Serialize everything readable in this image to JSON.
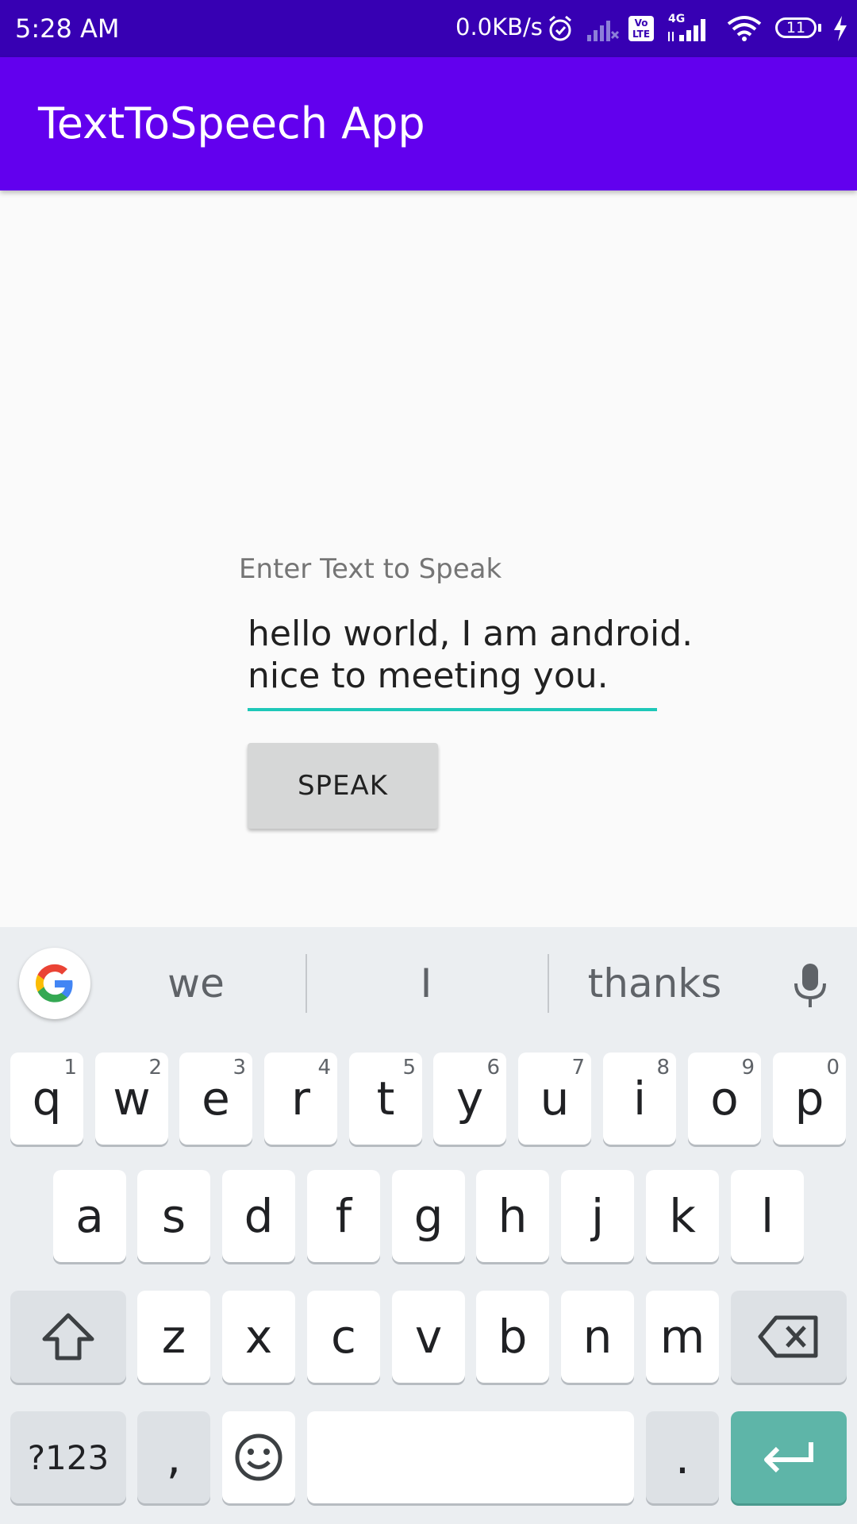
{
  "status_bar": {
    "time": "5:28 AM",
    "net_speed": "0.0KB/s",
    "volte": "Vo LTE",
    "network": "4G",
    "battery": "11"
  },
  "app_bar": {
    "title": "TextToSpeech App"
  },
  "form": {
    "label": "Enter Text to Speak",
    "input_lines": [
      "hello world, I am android.",
      "nice to meeting you."
    ],
    "speak_button": "SPEAK"
  },
  "keyboard": {
    "suggestions": [
      "we",
      "I",
      "thanks"
    ],
    "row1": [
      {
        "k": "q",
        "n": "1"
      },
      {
        "k": "w",
        "n": "2"
      },
      {
        "k": "e",
        "n": "3"
      },
      {
        "k": "r",
        "n": "4"
      },
      {
        "k": "t",
        "n": "5"
      },
      {
        "k": "y",
        "n": "6"
      },
      {
        "k": "u",
        "n": "7"
      },
      {
        "k": "i",
        "n": "8"
      },
      {
        "k": "o",
        "n": "9"
      },
      {
        "k": "p",
        "n": "0"
      }
    ],
    "row2": [
      "a",
      "s",
      "d",
      "f",
      "g",
      "h",
      "j",
      "k",
      "l"
    ],
    "row3": [
      "z",
      "x",
      "c",
      "v",
      "b",
      "n",
      "m"
    ],
    "symbols_key": "?123",
    "comma_key": ",",
    "period_key": ".",
    "colors": {
      "enter": "#5eb5a8",
      "accent": "#6200ee",
      "underline": "#1ec8b8"
    }
  }
}
